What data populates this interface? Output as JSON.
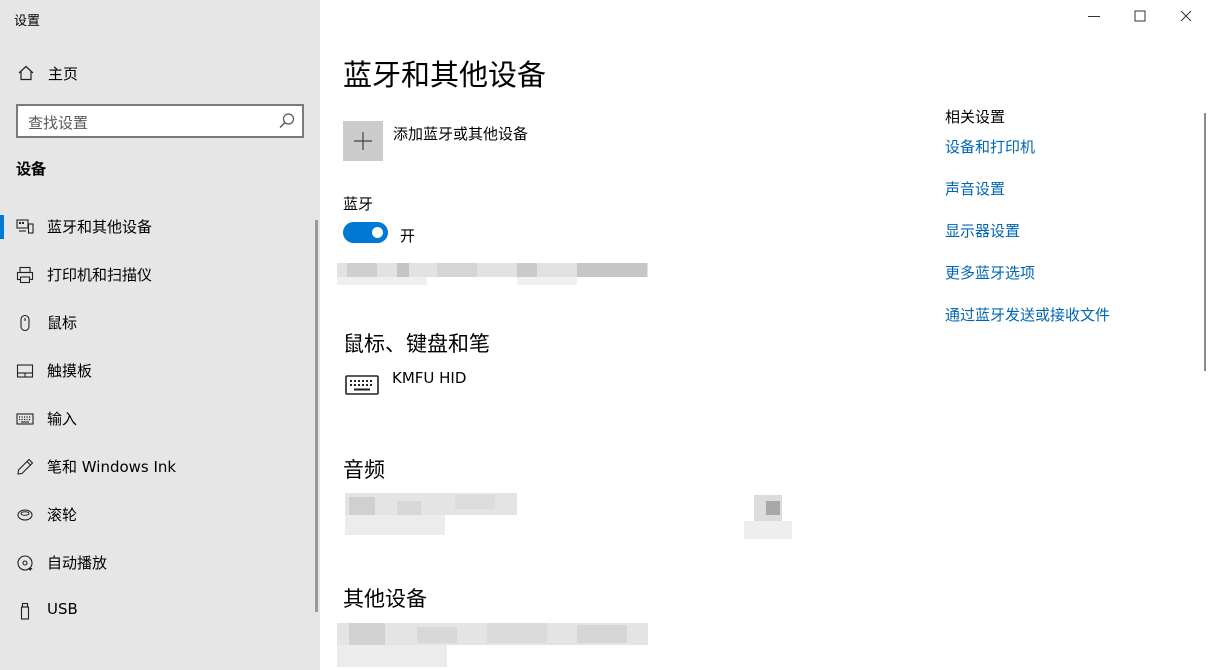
{
  "window": {
    "title": "设置",
    "controls": [
      "minimize",
      "maximize",
      "close"
    ]
  },
  "sidebar": {
    "home_label": "主页",
    "search_placeholder": "查找设置",
    "section_title": "设备",
    "items": [
      {
        "label": "蓝牙和其他设备",
        "icon": "bluetooth-devices-icon",
        "active": true
      },
      {
        "label": "打印机和扫描仪",
        "icon": "printer-icon",
        "active": false
      },
      {
        "label": "鼠标",
        "icon": "mouse-icon",
        "active": false
      },
      {
        "label": "触摸板",
        "icon": "touchpad-icon",
        "active": false
      },
      {
        "label": "输入",
        "icon": "keyboard-icon",
        "active": false
      },
      {
        "label": "笔和 Windows Ink",
        "icon": "pen-icon",
        "active": false
      },
      {
        "label": "滚轮",
        "icon": "wheel-icon",
        "active": false
      },
      {
        "label": "自动播放",
        "icon": "autoplay-icon",
        "active": false
      },
      {
        "label": "USB",
        "icon": "usb-icon",
        "active": false
      }
    ]
  },
  "main": {
    "title": "蓝牙和其他设备",
    "add_device_label": "添加蓝牙或其他设备",
    "bluetooth": {
      "label": "蓝牙",
      "state_label": "开",
      "enabled": true
    },
    "sections": {
      "input_devices": "鼠标、键盘和笔",
      "audio": "音频",
      "other_devices": "其他设备"
    },
    "keyboard_device": {
      "name": "KMFU HID",
      "icon": "keyboard-icon"
    }
  },
  "related": {
    "title": "相关设置",
    "links": [
      "设备和打印机",
      "声音设置",
      "显示器设置",
      "更多蓝牙选项",
      "通过蓝牙发送或接收文件"
    ]
  },
  "colors": {
    "accent": "#0078d4",
    "link": "#0066b4",
    "sidebar_bg": "#e6e6e6"
  }
}
